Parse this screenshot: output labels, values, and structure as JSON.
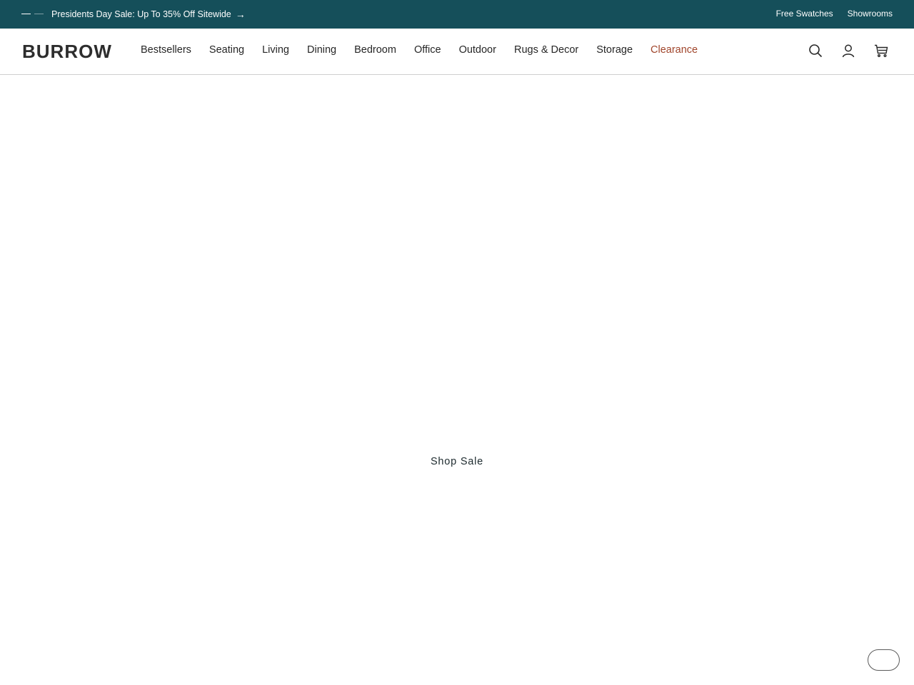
{
  "announcement": {
    "promo_text": "Presidents Day Sale: Up To 35% Off Sitewide",
    "promo_arrow": "→",
    "utility_links": [
      "Free Swatches",
      "Showrooms"
    ],
    "background_color": "#154f5a"
  },
  "header": {
    "logo_text": "BURROW",
    "nav_items": [
      {
        "label": "Bestsellers"
      },
      {
        "label": "Seating"
      },
      {
        "label": "Living"
      },
      {
        "label": "Dining"
      },
      {
        "label": "Bedroom"
      },
      {
        "label": "Office"
      },
      {
        "label": "Outdoor"
      },
      {
        "label": "Rugs & Decor"
      },
      {
        "label": "Storage"
      },
      {
        "label": "Clearance"
      }
    ],
    "clearance_color": "#a0452b",
    "icons": [
      "search-icon",
      "account-icon",
      "cart-icon"
    ]
  },
  "hero": {
    "cta_label": "Shop Sale"
  }
}
